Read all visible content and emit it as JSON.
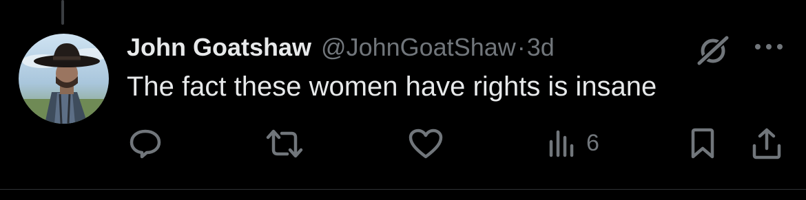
{
  "post": {
    "display_name": "John Goatshaw",
    "handle": "@JohnGoatShaw",
    "separator": "·",
    "time": "3d",
    "text": "The fact these women have rights is insane"
  },
  "actions": {
    "reply_icon": "reply-icon",
    "repost_icon": "repost-icon",
    "like_icon": "heart-icon",
    "views_icon": "views-chart-icon",
    "views_count": "6",
    "bookmark_icon": "bookmark-icon",
    "share_icon": "share-icon"
  },
  "colors": {
    "background": "#000000",
    "primary_text": "#e7e9ea",
    "secondary_text": "#71767b",
    "divider": "#2f3336"
  }
}
